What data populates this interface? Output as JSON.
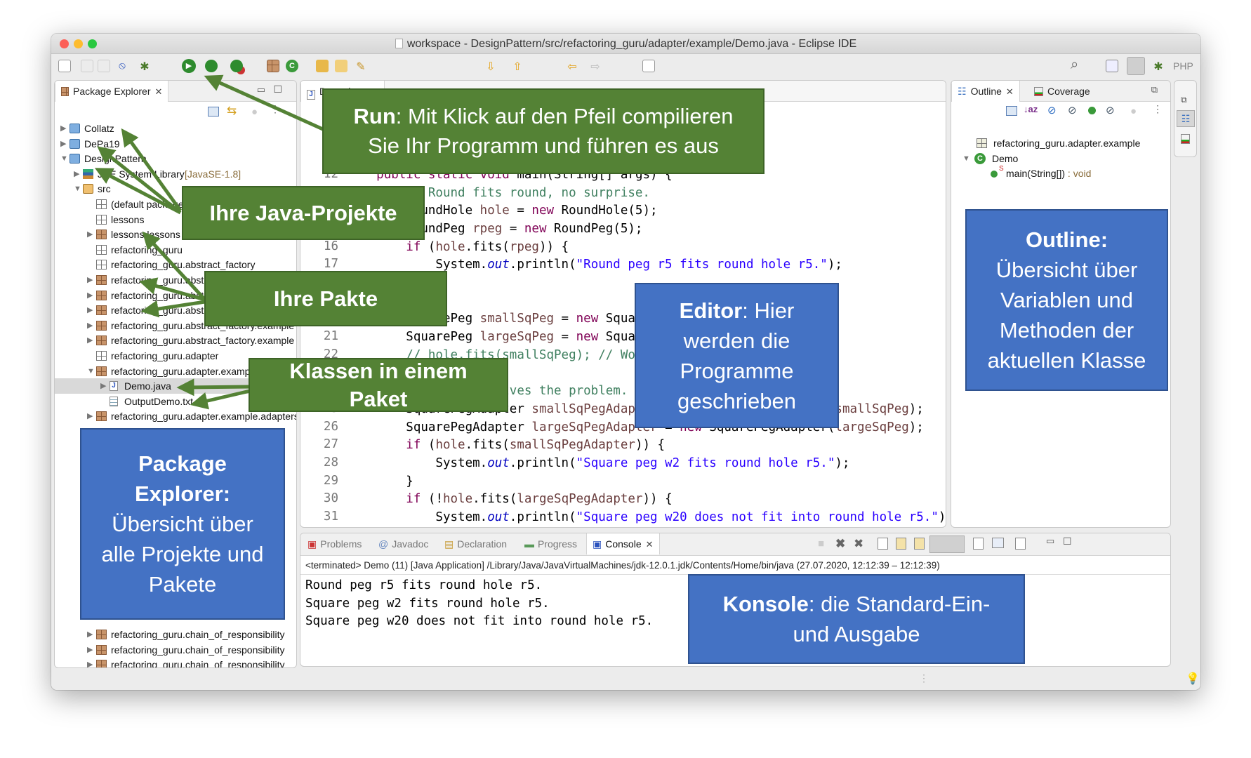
{
  "window": {
    "title": "workspace - DesignPattern/src/refactoring_guru/adapter/example/Demo.java - Eclipse IDE"
  },
  "toolbar": {
    "icons": [
      "new-wizard",
      "save",
      "save-all",
      "skip-breakpoints",
      "debug",
      "run",
      "coverage",
      "external-tools",
      "new-java-package",
      "new-java-class",
      "open-type",
      "open-task",
      "search",
      "next-annotation",
      "previous-annotation",
      "back",
      "forward",
      "pin-editor"
    ],
    "right_label": "PHP"
  },
  "package_explorer": {
    "tab_label": "Package Explorer",
    "rows": [
      {
        "level": 0,
        "label": "Collatz",
        "icon": "project",
        "exp": "closed"
      },
      {
        "level": 0,
        "label": "DePa19",
        "icon": "project",
        "exp": "closed"
      },
      {
        "level": 0,
        "label": "DesignPattern",
        "icon": "project",
        "exp": "open"
      },
      {
        "level": 1,
        "label": "JRE System Library",
        "suffix": " [JavaSE-1.8]",
        "icon": "library",
        "exp": "closed"
      },
      {
        "level": 1,
        "label": "src",
        "icon": "src",
        "exp": "open"
      },
      {
        "level": 2,
        "label": "(default package)",
        "icon": "pkg-empty",
        "exp": ""
      },
      {
        "level": 2,
        "label": "lessons",
        "icon": "pkg-empty",
        "exp": ""
      },
      {
        "level": 2,
        "label": "lessons.lessons",
        "icon": "pkg",
        "exp": "closed"
      },
      {
        "level": 2,
        "label": "refactoring_guru",
        "icon": "pkg-empty",
        "exp": ""
      },
      {
        "level": 2,
        "label": "refactoring_guru.abstract_factory",
        "icon": "pkg-empty",
        "exp": ""
      },
      {
        "level": 2,
        "label": "refactoring_guru.abstract_factory.example",
        "icon": "pkg",
        "exp": "closed"
      },
      {
        "level": 2,
        "label": "refactoring_guru.abstract_factory.example",
        "icon": "pkg",
        "exp": "closed"
      },
      {
        "level": 2,
        "label": "refactoring_guru.abstract_factory.example",
        "icon": "pkg",
        "exp": "closed"
      },
      {
        "level": 2,
        "label": "refactoring_guru.abstract_factory.example",
        "icon": "pkg",
        "exp": "closed"
      },
      {
        "level": 2,
        "label": "refactoring_guru.abstract_factory.example",
        "icon": "pkg",
        "exp": "closed"
      },
      {
        "level": 2,
        "label": "refactoring_guru.adapter",
        "icon": "pkg-empty",
        "exp": ""
      },
      {
        "level": 2,
        "label": "refactoring_guru.adapter.example",
        "icon": "pkg",
        "exp": "open"
      },
      {
        "level": 3,
        "label": "Demo.java",
        "icon": "java",
        "exp": "closed",
        "selected": true
      },
      {
        "level": 3,
        "label": "OutputDemo.txt",
        "icon": "txt",
        "exp": ""
      },
      {
        "level": 2,
        "label": "refactoring_guru.adapter.example.adapters",
        "icon": "pkg",
        "exp": "closed"
      }
    ],
    "bottom_rows": [
      {
        "level": 2,
        "label": "refactoring_guru.chain_of_responsibility",
        "icon": "pkg",
        "exp": "closed"
      },
      {
        "level": 2,
        "label": "refactoring_guru.chain_of_responsibility",
        "icon": "pkg",
        "exp": "closed"
      },
      {
        "level": 2,
        "label": "refactoring_guru.chain_of_responsibility",
        "icon": "pkg",
        "exp": "closed"
      }
    ]
  },
  "editor": {
    "tab_label": "Demo.java",
    "lines": [
      {
        "n": "8",
        "t": []
      },
      {
        "n": "9",
        "t": []
      },
      {
        "n": "10",
        "t": []
      },
      {
        "n": "11",
        "t": []
      },
      {
        "n": "12",
        "t": [
          [
            "    ",
            "plain"
          ],
          [
            "public",
            "kw"
          ],
          [
            " ",
            "plain"
          ],
          [
            "static",
            "kw"
          ],
          [
            " ",
            "plain"
          ],
          [
            "void",
            "kw"
          ],
          [
            " main(String[] args) {",
            "plain"
          ]
        ]
      },
      {
        "n": "13",
        "t": [
          [
            "        // Round fits round, no surprise.",
            "com"
          ]
        ]
      },
      {
        "n": "14",
        "t": [
          [
            "        RoundHole ",
            "plain"
          ],
          [
            "hole",
            "var"
          ],
          [
            " = ",
            "plain"
          ],
          [
            "new",
            "kw"
          ],
          [
            " RoundHole(5);",
            "plain"
          ]
        ]
      },
      {
        "n": "15",
        "t": [
          [
            "        RoundPeg ",
            "plain"
          ],
          [
            "rpeg",
            "var"
          ],
          [
            " = ",
            "plain"
          ],
          [
            "new",
            "kw"
          ],
          [
            " RoundPeg(5);",
            "plain"
          ]
        ]
      },
      {
        "n": "16",
        "t": [
          [
            "        ",
            "plain"
          ],
          [
            "if",
            "kw"
          ],
          [
            " (",
            "plain"
          ],
          [
            "hole",
            "var"
          ],
          [
            ".fits(",
            "plain"
          ],
          [
            "rpeg",
            "var"
          ],
          [
            ")) {",
            "plain"
          ]
        ]
      },
      {
        "n": "17",
        "t": [
          [
            "            System.",
            "plain"
          ],
          [
            "out",
            "fld"
          ],
          [
            ".println(",
            "plain"
          ],
          [
            "\"Round peg r5 fits round hole r5.\"",
            "str"
          ],
          [
            ");",
            "plain"
          ]
        ]
      },
      {
        "n": "18",
        "t": [
          [
            "        }",
            "plain"
          ]
        ]
      },
      {
        "n": "19",
        "t": []
      },
      {
        "n": "20",
        "t": [
          [
            "        SquarePeg ",
            "plain"
          ],
          [
            "smallSqPeg",
            "var"
          ],
          [
            " = ",
            "plain"
          ],
          [
            "new",
            "kw"
          ],
          [
            " SquarePeg(2);",
            "plain"
          ]
        ]
      },
      {
        "n": "21",
        "t": [
          [
            "        SquarePeg ",
            "plain"
          ],
          [
            "largeSqPeg",
            "var"
          ],
          [
            " = ",
            "plain"
          ],
          [
            "new",
            "kw"
          ],
          [
            " SquarePeg(20);",
            "plain"
          ]
        ]
      },
      {
        "n": "22",
        "t": [
          [
            "        // hole.fits(smallSqPeg); // Won't compile.",
            "com"
          ]
        ]
      },
      {
        "n": "23",
        "t": []
      },
      {
        "n": "24",
        "t": [
          [
            "        // Adapter solves the problem.",
            "com"
          ]
        ]
      },
      {
        "n": "25",
        "t": [
          [
            "        SquarePegAdapter ",
            "plain"
          ],
          [
            "smallSqPegAdapter",
            "var"
          ],
          [
            " = ",
            "plain"
          ],
          [
            "new",
            "kw"
          ],
          [
            " SquarePegAdapter(",
            "plain"
          ],
          [
            "smallSqPeg",
            "var"
          ],
          [
            ");",
            "plain"
          ]
        ]
      },
      {
        "n": "26",
        "t": [
          [
            "        SquarePegAdapter ",
            "plain"
          ],
          [
            "largeSqPegAdapter",
            "var"
          ],
          [
            " = ",
            "plain"
          ],
          [
            "new",
            "kw"
          ],
          [
            " SquarePegAdapter(",
            "plain"
          ],
          [
            "largeSqPeg",
            "var"
          ],
          [
            ");",
            "plain"
          ]
        ]
      },
      {
        "n": "27",
        "t": [
          [
            "        ",
            "plain"
          ],
          [
            "if",
            "kw"
          ],
          [
            " (",
            "plain"
          ],
          [
            "hole",
            "var"
          ],
          [
            ".fits(",
            "plain"
          ],
          [
            "smallSqPegAdapter",
            "var"
          ],
          [
            ")) {",
            "plain"
          ]
        ]
      },
      {
        "n": "28",
        "t": [
          [
            "            System.",
            "plain"
          ],
          [
            "out",
            "fld"
          ],
          [
            ".println(",
            "plain"
          ],
          [
            "\"Square peg w2 fits round hole r5.\"",
            "str"
          ],
          [
            ");",
            "plain"
          ]
        ]
      },
      {
        "n": "29",
        "t": [
          [
            "        }",
            "plain"
          ]
        ]
      },
      {
        "n": "30",
        "t": [
          [
            "        ",
            "plain"
          ],
          [
            "if",
            "kw"
          ],
          [
            " (!",
            "plain"
          ],
          [
            "hole",
            "var"
          ],
          [
            ".fits(",
            "plain"
          ],
          [
            "largeSqPegAdapter",
            "var"
          ],
          [
            ")) {",
            "plain"
          ]
        ]
      },
      {
        "n": "31",
        "t": [
          [
            "            System.",
            "plain"
          ],
          [
            "out",
            "fld"
          ],
          [
            ".println(",
            "plain"
          ],
          [
            "\"Square peg w20 does not fit into round hole r5.\"",
            "str"
          ],
          [
            ");",
            "plain"
          ]
        ]
      }
    ]
  },
  "outline": {
    "tabs": [
      "Outline",
      "Coverage"
    ],
    "package": "refactoring_guru.adapter.example",
    "class_name": "Demo",
    "method": "main(String[])",
    "method_type": " : void"
  },
  "console": {
    "tabs": [
      "Problems",
      "Javadoc",
      "Declaration",
      "Progress",
      "Console"
    ],
    "header": "<terminated> Demo (11) [Java Application] /Library/Java/JavaVirtualMachines/jdk-12.0.1.jdk/Contents/Home/bin/java  (27.07.2020, 12:12:39 – 12:12:39)",
    "output": [
      "Round peg r5 fits round hole r5.",
      "Square peg w2 fits round hole r5.",
      "Square peg w20 does not fit into round hole r5."
    ]
  },
  "callouts": {
    "run": {
      "bold": "Run",
      "line1": ": Mit Klick auf den Pfeil compilieren",
      "line2": "Sie Ihr Programm und führen es aus"
    },
    "projects": {
      "bold": "Ihre Java-Projekte"
    },
    "packages": {
      "bold": "Ihre Pakte"
    },
    "classes": {
      "line1": "Klassen in einem",
      "line2": "Paket"
    },
    "package_explorer": {
      "line1": "Package",
      "line2": "Explorer:",
      "line3": "Übersicht über",
      "line4": "alle Projekte und",
      "line5": "Pakete"
    },
    "editor": {
      "bold": "Editor",
      "line1": ": Hier",
      "line2": "werden die",
      "line3": "Programme",
      "line4": "geschrieben"
    },
    "outline": {
      "bold": "Outline:",
      "line2": "Übersicht über",
      "line3": "Variablen und",
      "line4": "Methoden der",
      "line5": "aktuellen Klasse"
    },
    "console": {
      "bold": "Konsole",
      "line1": ": die Standard-Ein-",
      "line2": "und Ausgabe"
    }
  },
  "colors": {
    "callout_green": "#548235",
    "callout_blue": "#4472c4",
    "arrow": "#548235"
  }
}
